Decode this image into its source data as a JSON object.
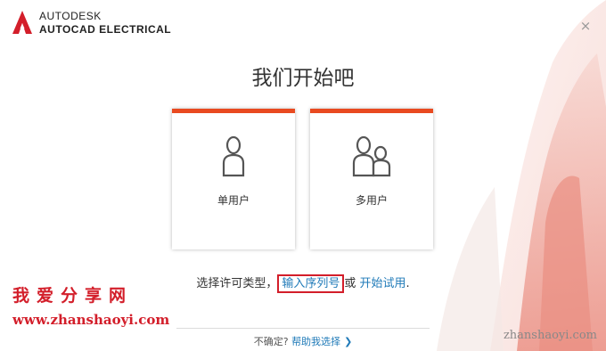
{
  "header": {
    "brand_top": "AUTODESK",
    "brand_bottom": "AUTOCAD ELECTRICAL",
    "close_glyph": "×"
  },
  "title": "我们开始吧",
  "cards": {
    "single_user": {
      "label": "单用户",
      "icon": "single-user-icon"
    },
    "multi_user": {
      "label": "多用户",
      "icon": "multi-user-icon"
    }
  },
  "license": {
    "prefix": "选择许可类型，",
    "serial_link": "输入序列号",
    "or_text": "或",
    "trial_link": "开始试用",
    "suffix": "."
  },
  "footer": {
    "unsure_text": "不确定?",
    "help_link": "帮助我选择",
    "chevron": "❯"
  },
  "watermark": {
    "site_cn": "我爱分享网",
    "url_left": "www.zhanshaoyi.com",
    "url_right": "zhanshaoyi.com"
  },
  "colors": {
    "accent": "#e94a20",
    "link": "#1f7ab8",
    "highlight_box": "#d31e2a",
    "watermark": "#d31e2a"
  }
}
